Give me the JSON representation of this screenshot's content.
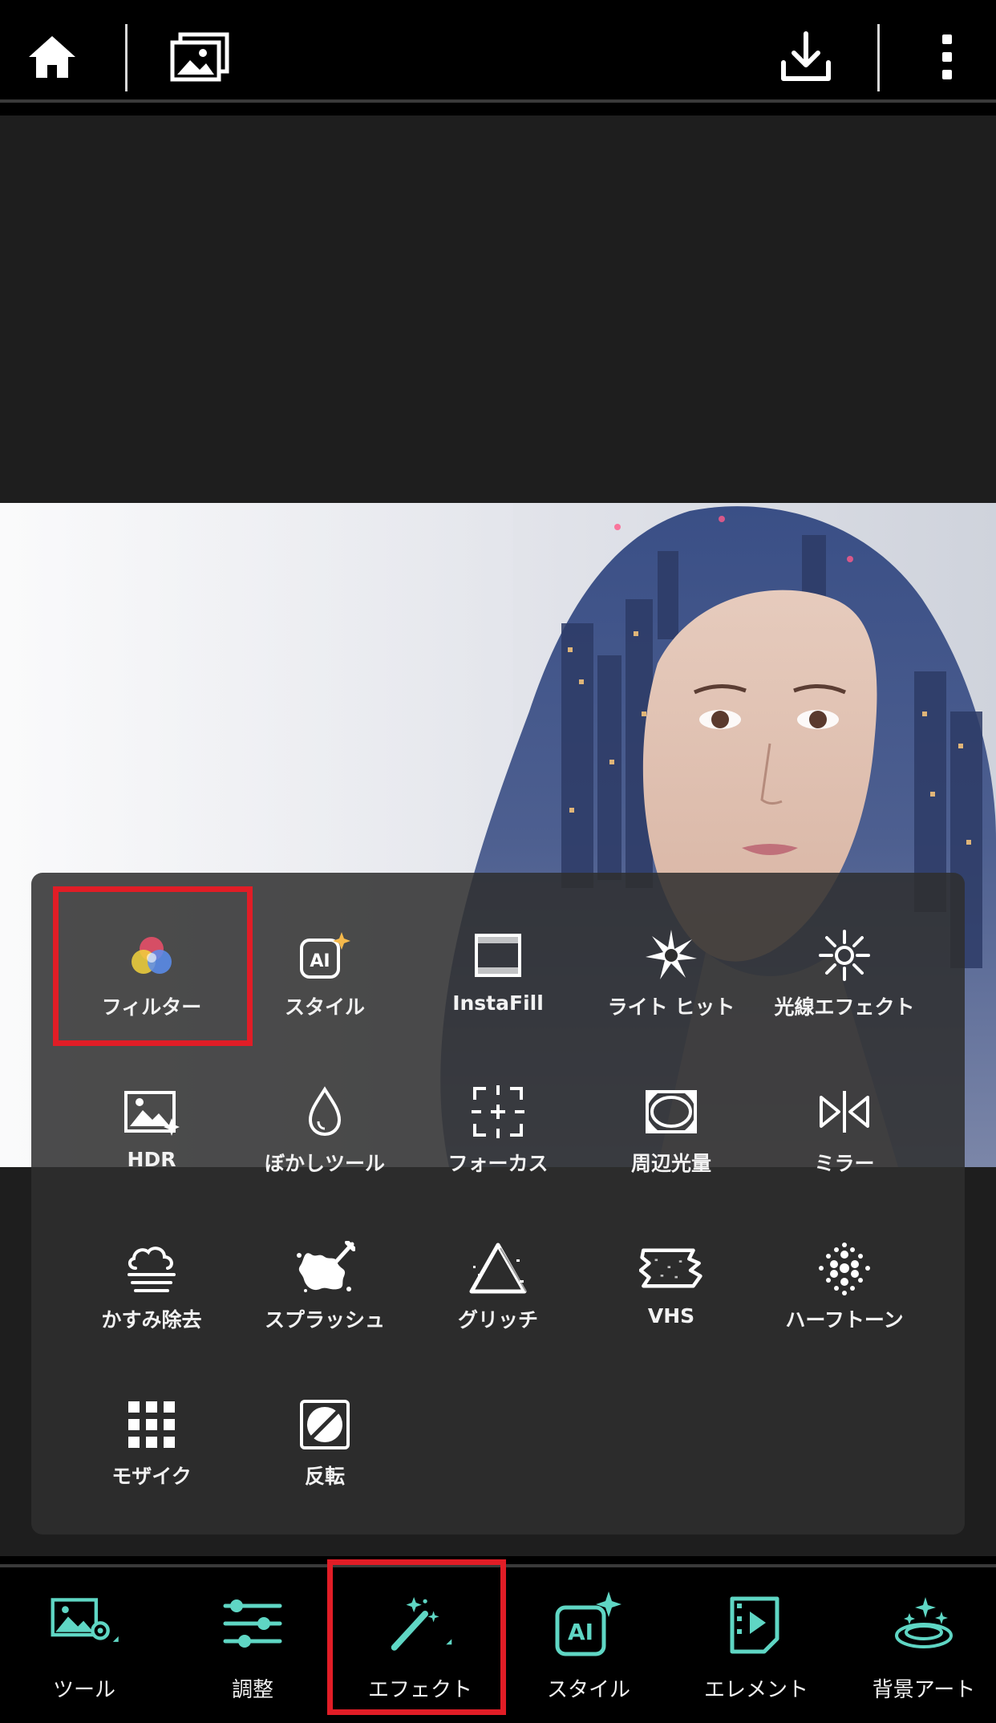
{
  "colors": {
    "accent": "#5fd6c4",
    "highlight": "#e11d26",
    "panel": "#2e2e2e",
    "background": "#1e1e1e"
  },
  "topbar": {
    "icons": [
      "home-icon",
      "gallery-icon",
      "download-icon",
      "more-icon"
    ]
  },
  "effects_panel": {
    "rows": [
      [
        {
          "label": "フィルター",
          "icon": "filter-icon",
          "highlighted": true
        },
        {
          "label": "スタイル",
          "icon": "ai-style-icon"
        },
        {
          "label": "InstaFill",
          "icon": "instafill-icon"
        },
        {
          "label": "ライト ヒット",
          "icon": "light-hit-icon"
        },
        {
          "label": "光線エフェクト",
          "icon": "light-rays-icon"
        }
      ],
      [
        {
          "label": "HDR",
          "icon": "hdr-icon"
        },
        {
          "label": "ぼかしツール",
          "icon": "blur-drop-icon"
        },
        {
          "label": "フォーカス",
          "icon": "focus-icon"
        },
        {
          "label": "周辺光量",
          "icon": "vignette-icon"
        },
        {
          "label": "ミラー",
          "icon": "mirror-icon"
        }
      ],
      [
        {
          "label": "かすみ除去",
          "icon": "dehaze-icon"
        },
        {
          "label": "スプラッシュ",
          "icon": "splash-icon"
        },
        {
          "label": "グリッチ",
          "icon": "glitch-icon"
        },
        {
          "label": "VHS",
          "icon": "vhs-icon"
        },
        {
          "label": "ハーフトーン",
          "icon": "halftone-icon"
        }
      ],
      [
        {
          "label": "モザイク",
          "icon": "mosaic-icon"
        },
        {
          "label": "反転",
          "icon": "invert-icon"
        }
      ]
    ]
  },
  "bottom_toolbar": {
    "items": [
      {
        "label": "ツール",
        "icon": "tools-icon"
      },
      {
        "label": "調整",
        "icon": "adjust-sliders-icon"
      },
      {
        "label": "エフェクト",
        "icon": "magic-wand-icon",
        "selected": true
      },
      {
        "label": "スタイル",
        "icon": "ai-style-icon"
      },
      {
        "label": "エレメント",
        "icon": "elements-icon"
      },
      {
        "label": "背景アート",
        "icon": "background-art-icon"
      }
    ]
  }
}
